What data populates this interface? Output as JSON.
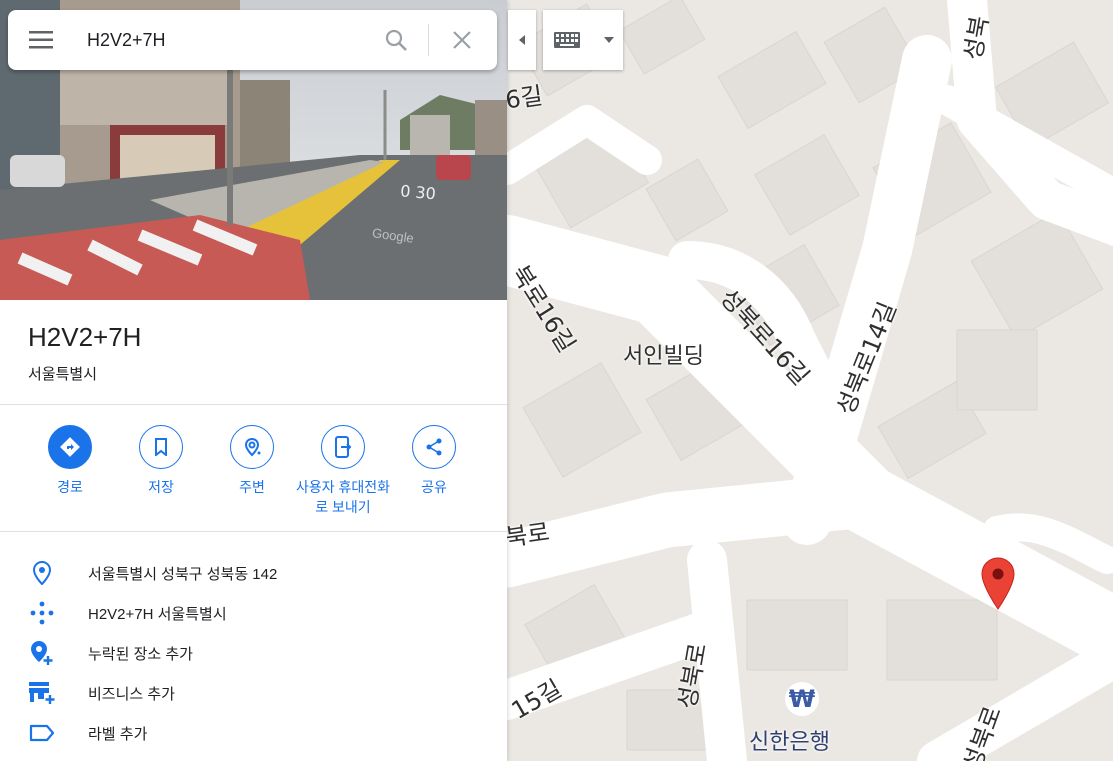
{
  "search": {
    "query": "H2V2+7H"
  },
  "place": {
    "title": "H2V2+7H",
    "subtitle": "서울특별시",
    "photo_watermark": "Google"
  },
  "actions": [
    {
      "label": "경로",
      "icon": "directions-icon"
    },
    {
      "label": "저장",
      "icon": "bookmark-icon"
    },
    {
      "label": "주변",
      "icon": "nearby-icon"
    },
    {
      "label": "사용자 휴대전화로 보내기",
      "icon": "send-to-phone-icon"
    },
    {
      "label": "공유",
      "icon": "share-icon"
    }
  ],
  "details": [
    {
      "text": "서울특별시 성북구 성북동 142",
      "icon": "location-pin-icon"
    },
    {
      "text": "H2V2+7H 서울특별시",
      "icon": "plus-code-icon"
    },
    {
      "text": "누락된 장소 추가",
      "icon": "add-place-icon"
    },
    {
      "text": "비즈니스 추가",
      "icon": "add-business-icon"
    },
    {
      "text": "라벨 추가",
      "icon": "label-icon"
    }
  ],
  "map": {
    "labels": {
      "road_16gil_top": "6길",
      "road_seongbukro_16gil_left": "북로16길",
      "road_seongbukro_16gil_mid": "성북로16길",
      "road_seongbukro_14gil": "성북로14길",
      "building_seoin": "서인빌딩",
      "road_bukro": "북로",
      "road_15gil": "15길",
      "road_seongbukro_bottom": "성북로",
      "road_seongbuk_top": "성북",
      "road_seongbuk_bottom_right": "성북로",
      "bank_shinhan": "신한은행",
      "bank_symbol": "₩"
    },
    "colors": {
      "pin": "#ea4335",
      "accent": "#1a73e8",
      "road": "#ffffff",
      "block": "#e6e3de"
    }
  }
}
